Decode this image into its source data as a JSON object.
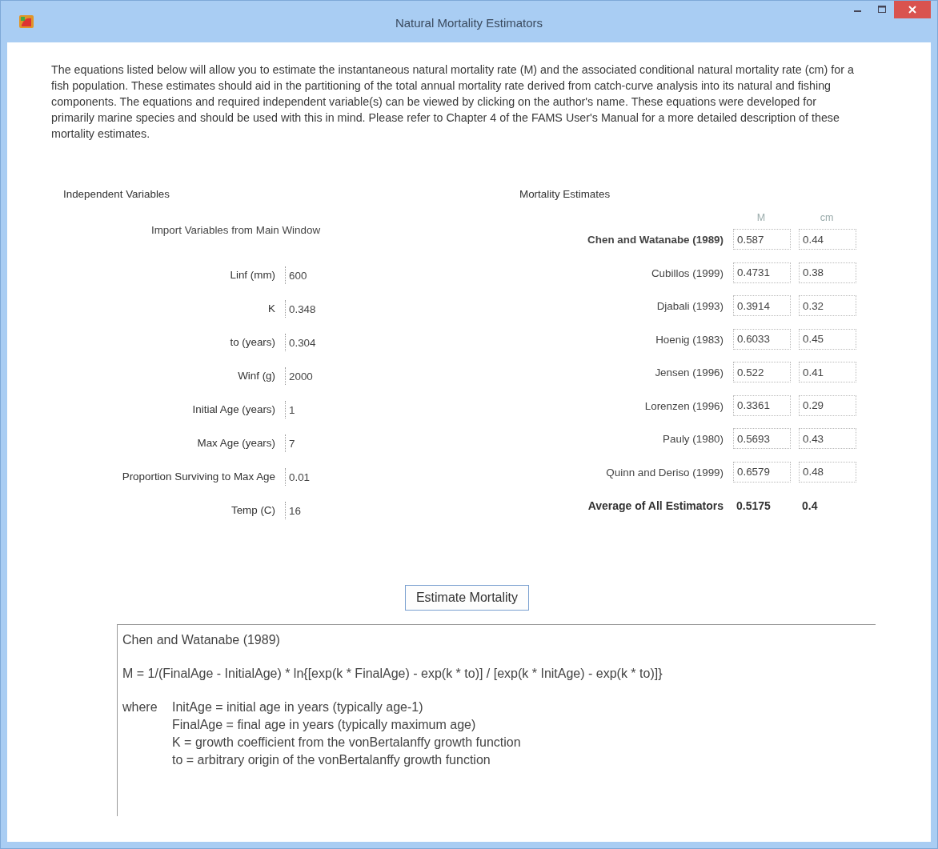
{
  "window": {
    "title": "Natural Mortality Estimators"
  },
  "intro": "The equations listed below will allow you to estimate the instantaneous natural mortality rate (M) and the associated conditional natural mortality rate (cm) for a fish population.  These estimates should aid in the partitioning of the total annual mortality rate derived from catch-curve analysis into its natural and fishing components. The equations and required independent variable(s) can be viewed by clicking on the author's name.  These equations were developed for primarily marine species and should be used with this in mind.  Please refer to Chapter 4 of the FAMS User's Manual for a more detailed description of these mortality estimates.",
  "independent": {
    "title": "Independent Variables",
    "import_label": "Import Variables from Main Window",
    "variables": [
      {
        "label": "Linf (mm)",
        "value": "600"
      },
      {
        "label": "K",
        "value": "0.348"
      },
      {
        "label": "to (years)",
        "value": "0.304"
      },
      {
        "label": "Winf (g)",
        "value": "2000"
      },
      {
        "label": "Initial Age (years)",
        "value": "1"
      },
      {
        "label": "Max Age (years)",
        "value": "7"
      },
      {
        "label": "Proportion Surviving to Max Age",
        "value": "0.01"
      },
      {
        "label": "Temp (C)",
        "value": "16"
      }
    ]
  },
  "estimates": {
    "title": "Mortality Estimates",
    "columns": [
      "M",
      "cm"
    ],
    "rows": [
      {
        "name": "Chen and Watanabe (1989)",
        "m": "0.587",
        "cm": "0.44",
        "selected": true
      },
      {
        "name": "Cubillos (1999)",
        "m": "0.4731",
        "cm": "0.38",
        "selected": false
      },
      {
        "name": "Djabali (1993)",
        "m": "0.3914",
        "cm": "0.32",
        "selected": false
      },
      {
        "name": "Hoenig (1983)",
        "m": "0.6033",
        "cm": "0.45",
        "selected": false
      },
      {
        "name": "Jensen (1996)",
        "m": "0.522",
        "cm": "0.41",
        "selected": false
      },
      {
        "name": "Lorenzen (1996)",
        "m": "0.3361",
        "cm": "0.29",
        "selected": false
      },
      {
        "name": "Pauly (1980)",
        "m": "0.5693",
        "cm": "0.43",
        "selected": false
      },
      {
        "name": "Quinn and Deriso (1999)",
        "m": "0.6579",
        "cm": "0.48",
        "selected": false
      }
    ],
    "average": {
      "label": "Average of All Estimators",
      "m": "0.5175",
      "cm": "0.4"
    }
  },
  "button": "Estimate Mortality",
  "description": {
    "title": "Chen and Watanabe (1989)",
    "equation": "M = 1/(FinalAge - InitialAge) * ln{[exp(k * FinalAge) - exp(k * to)] / [exp(k * InitAge) - exp(k * to)]}",
    "where_label": "where",
    "definitions": [
      "InitAge = initial age in years (typically age-1)",
      "FinalAge = final age in years (typically maximum age)",
      "K = growth coefficient from the vonBertalanffy growth function",
      "to = arbitrary origin of the vonBertalanffy growth function"
    ]
  }
}
